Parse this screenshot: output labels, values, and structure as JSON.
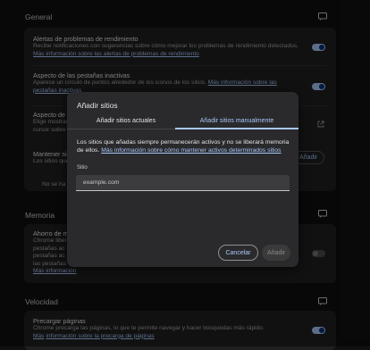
{
  "sections": {
    "general": "General",
    "memoria": "Memoria",
    "velocidad": "Velocidad"
  },
  "general": {
    "alerts": {
      "title": "Alertas de problemas de rendimiento",
      "desc": "Recibe notificaciones con sugerencias sobre cómo mejorar los problemas de rendimiento detectados.",
      "link": "Más información sobre las alertas de problemas de rendimiento"
    },
    "tabs_appearance": {
      "title": "Aspecto de las pestañas inactivas",
      "desc": "Aparece un círculo de puntos alrededor de los iconos de los sitios.",
      "link": "Más información sobre las pestañas inactivas"
    },
    "partial_row3_title": "Aspecto de l",
    "partial_row3_l1": "Elige mostrar",
    "partial_row3_l2": "cursor sobre",
    "partial_row4_title": "Mantener sie",
    "partial_row4_desc": "Los sitios que",
    "partial_row5": "No se ha",
    "add_button": "Añadir"
  },
  "memoria": {
    "partial_title": "Ahorro de m",
    "partial_l1": "Chrome liber",
    "partial_l2": "pestañas ac",
    "partial_l3": "pestañas ac",
    "partial_l4": "las pestañas",
    "partial_link": "Más información"
  },
  "velocidad": {
    "title": "Precargar páginas",
    "desc": "Chrome precarga las páginas, lo que te permite navegar y hacer búsquedas más rápido.",
    "link_pre": "Más",
    "link": "información sobre la precarga de páginas"
  },
  "dialog": {
    "title": "Añadir sitios",
    "tab_current": "Añadir sitios actuales",
    "tab_manual": "Añadir sitios manualmente",
    "body": "Los sitios que añadas siempre permanecerán activos y no se liberará memoria de ellos.",
    "body_link": "Más información sobre cómo mantener activos determinados sitios",
    "field_label": "Sitio",
    "input_placeholder": "example.com",
    "cancel": "Cancelar",
    "add": "Añadir"
  },
  "icons": [
    "feedback-icon",
    "external-link-icon"
  ],
  "colors": {
    "accent": "#a8c7fa",
    "background": "#101010",
    "card": "#1f1f1f",
    "dialog": "#2a2a2c"
  }
}
